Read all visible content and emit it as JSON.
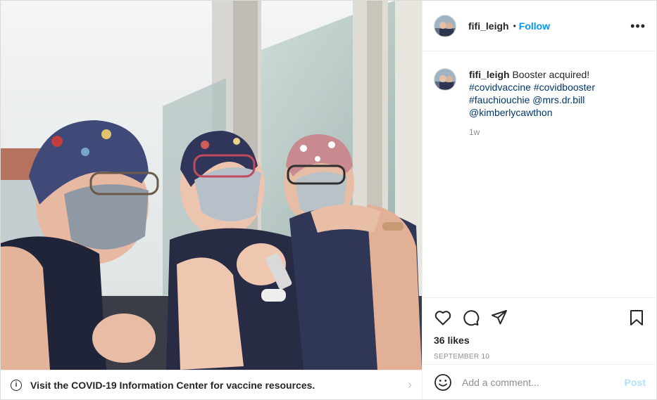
{
  "post": {
    "author": "fifi_leigh",
    "separator": "•",
    "follow_label": "Follow",
    "more_label": "•••",
    "caption": {
      "username": "fifi_leigh",
      "text": "Booster acquired!",
      "hashtags": [
        "#covidvaccine",
        "#covidbooster",
        "#fauchiouchie"
      ],
      "mentions": [
        "@mrs.dr.bill",
        "@kimberlycawthon"
      ]
    },
    "time_ago": "1w",
    "likes": "36 likes",
    "date": "SEPTEMBER 10"
  },
  "banner": {
    "text": "Visit the COVID-19 Information Center for vaccine resources.",
    "info_icon_glyph": "i",
    "chevron_glyph": "›"
  },
  "comment_box": {
    "placeholder": "Add a comment...",
    "post_label": "Post"
  },
  "icons": [
    "heart-icon",
    "comment-icon",
    "share-icon",
    "bookmark-icon",
    "emoji-icon",
    "info-icon",
    "chevron-right-icon",
    "more-options-icon"
  ],
  "colors": {
    "follow": "#0095f6",
    "tag": "#00376b",
    "post_disabled": "#b2dffc",
    "muted": "#8e8e8e"
  }
}
